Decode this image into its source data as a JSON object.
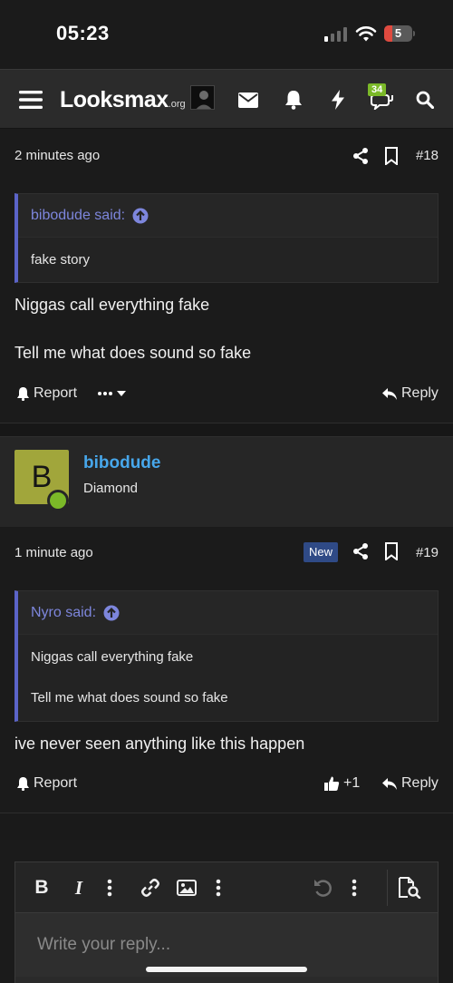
{
  "status_bar": {
    "time": "05:23",
    "battery": "5"
  },
  "header": {
    "logo": "Looksmax",
    "logo_suffix": ".org",
    "conversations_badge": "34",
    "icons": [
      "menu-icon",
      "avatar",
      "envelope-icon",
      "bell-icon",
      "bolt-icon",
      "chat-bubbles-icon",
      "search-icon"
    ]
  },
  "posts": [
    {
      "time": "2 minutes ago",
      "number": "#18",
      "quote": {
        "author": "bibodude said:",
        "lines": [
          "fake story"
        ]
      },
      "body": [
        "Niggas call everything fake",
        "Tell me what does sound so fake"
      ],
      "actions": {
        "report": "Report",
        "reply": "Reply"
      }
    },
    {
      "author": {
        "name": "bibodude",
        "initial": "B",
        "title": "Diamond"
      },
      "time": "1 minute ago",
      "badge": "New",
      "number": "#19",
      "quote": {
        "author": "Nyro said:",
        "lines": [
          "Niggas call everything fake",
          "Tell me what does sound so fake"
        ]
      },
      "body": [
        "ive never seen anything like this happen"
      ],
      "actions": {
        "report": "Report",
        "reactions": "+1",
        "reply": "Reply"
      }
    }
  ],
  "editor": {
    "placeholder": "Write your reply..."
  },
  "colors": {
    "accent_link": "#47a7eb",
    "quote_bar": "#5b64c8",
    "online": "#7bb928",
    "avatar_bg": "#a1a63b"
  }
}
